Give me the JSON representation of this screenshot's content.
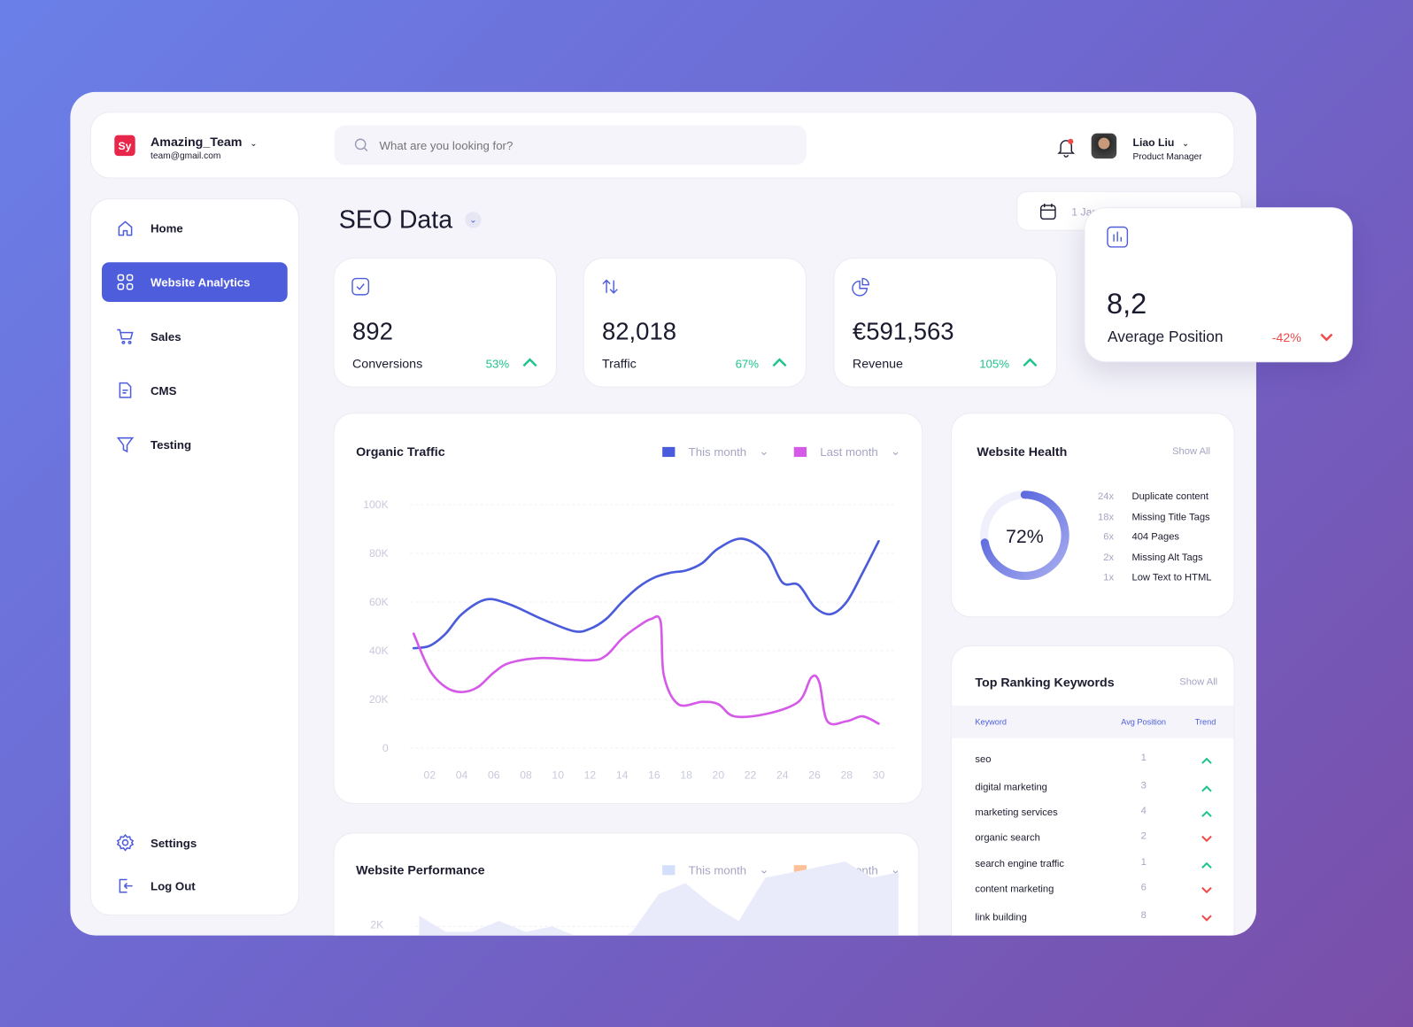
{
  "workspace": {
    "logo": "Sy",
    "name": "Amazing_Team",
    "email": "team@gmail.com"
  },
  "search": {
    "placeholder": "What are you looking for?"
  },
  "user": {
    "name": "Liao Liu",
    "role": "Product Manager"
  },
  "sidebar": {
    "items": [
      {
        "label": "Home",
        "icon": "home-icon"
      },
      {
        "label": "Website Analytics",
        "icon": "grid-icon",
        "active": true
      },
      {
        "label": "Sales",
        "icon": "cart-icon"
      },
      {
        "label": "CMS",
        "icon": "document-icon"
      },
      {
        "label": "Testing",
        "icon": "funnel-icon"
      }
    ],
    "bottom": [
      {
        "label": "Settings",
        "icon": "gear-icon"
      },
      {
        "label": "Log Out",
        "icon": "logout-icon"
      }
    ]
  },
  "page": {
    "title": "SEO Data",
    "date": "1 Jan"
  },
  "stats": [
    {
      "value": "892",
      "label": "Conversions",
      "change": "53%",
      "trend": "up",
      "icon": "checkbox-icon"
    },
    {
      "value": "82,018",
      "label": "Traffic",
      "change": "67%",
      "trend": "up",
      "icon": "swap-icon"
    },
    {
      "value": "€591,563",
      "label": "Revenue",
      "change": "105%",
      "trend": "up",
      "icon": "pie-icon"
    },
    {
      "value": "8,2",
      "label": "Average Position",
      "change": "-42%",
      "trend": "down",
      "icon": "bar-chart-icon"
    }
  ],
  "colors": {
    "accent": "#4d5ddc",
    "this_month": "#4a5bdc",
    "last_month": "#d65ae8",
    "up": "#1ec48a",
    "down": "#f04a4a"
  },
  "chart_data": [
    {
      "type": "line",
      "title": "Organic Traffic",
      "ylim": [
        0,
        100000
      ],
      "yticks": [
        "100K",
        "80K",
        "60K",
        "40K",
        "20K",
        "0"
      ],
      "xticks": [
        "02",
        "04",
        "06",
        "08",
        "10",
        "12",
        "14",
        "16",
        "18",
        "20",
        "22",
        "24",
        "26",
        "28",
        "30"
      ],
      "series": [
        {
          "name": "This month",
          "x": [
            1,
            2,
            3,
            4,
            5.5,
            7,
            9,
            11,
            12,
            13,
            14,
            15,
            16,
            17,
            18,
            19,
            20,
            21.5,
            23,
            24,
            25,
            26,
            27,
            28,
            29,
            30
          ],
          "values": [
            41000,
            42000,
            47000,
            55000,
            61000,
            59000,
            53000,
            48000,
            49000,
            53000,
            60000,
            66000,
            70000,
            72000,
            73000,
            76000,
            82000,
            86000,
            80000,
            68000,
            67000,
            58000,
            55000,
            60000,
            72000,
            85000
          ]
        },
        {
          "name": "Last month",
          "x": [
            1,
            2,
            3,
            4,
            5,
            6,
            7,
            9,
            12,
            13,
            14,
            15,
            15.8,
            16.4,
            16.6,
            17.5,
            19,
            20,
            21,
            23,
            25,
            25.8,
            26.3,
            26.8,
            28,
            29,
            30
          ],
          "values": [
            47000,
            32000,
            25000,
            23000,
            25000,
            31000,
            35000,
            37000,
            36000,
            38000,
            45000,
            50000,
            53000,
            52000,
            30000,
            18000,
            19000,
            18000,
            13000,
            14000,
            19000,
            29000,
            27000,
            11000,
            11000,
            13000,
            10000
          ]
        }
      ]
    },
    {
      "type": "area",
      "title": "Website Performance",
      "yticks": [
        "2K"
      ],
      "series": [
        {
          "name": "This month",
          "color": "#d4e0fb"
        },
        {
          "name": "Last month",
          "color": "#fdc096"
        }
      ],
      "values_visible": [
        2100,
        1950,
        1950,
        2050,
        1950,
        2000,
        1900,
        1800,
        1950,
        2300,
        2400,
        2200,
        2050,
        2450,
        2500,
        2550,
        2600,
        2450,
        2500
      ]
    }
  ],
  "health": {
    "title": "Website Health",
    "show_all": "Show All",
    "percent": 72,
    "percent_label": "72%",
    "issues": [
      {
        "count": "24x",
        "label": "Duplicate content"
      },
      {
        "count": "18x",
        "label": "Missing Title Tags"
      },
      {
        "count": "6x",
        "label": "404 Pages"
      },
      {
        "count": "2x",
        "label": "Missing Alt Tags"
      },
      {
        "count": "1x",
        "label": "Low Text to HTML"
      }
    ]
  },
  "keywords": {
    "title": "Top Ranking Keywords",
    "show_all": "Show All",
    "columns": [
      "Keyword",
      "Avg Position",
      "Trend"
    ],
    "rows": [
      {
        "keyword": "seo",
        "pos": "1",
        "trend": "up"
      },
      {
        "keyword": "digital marketing",
        "pos": "3",
        "trend": "up"
      },
      {
        "keyword": "marketing services",
        "pos": "4",
        "trend": "up"
      },
      {
        "keyword": "organic search",
        "pos": "2",
        "trend": "down"
      },
      {
        "keyword": "search engine traffic",
        "pos": "1",
        "trend": "up"
      },
      {
        "keyword": "content marketing",
        "pos": "6",
        "trend": "down"
      },
      {
        "keyword": "link building",
        "pos": "8",
        "trend": "down"
      }
    ]
  }
}
